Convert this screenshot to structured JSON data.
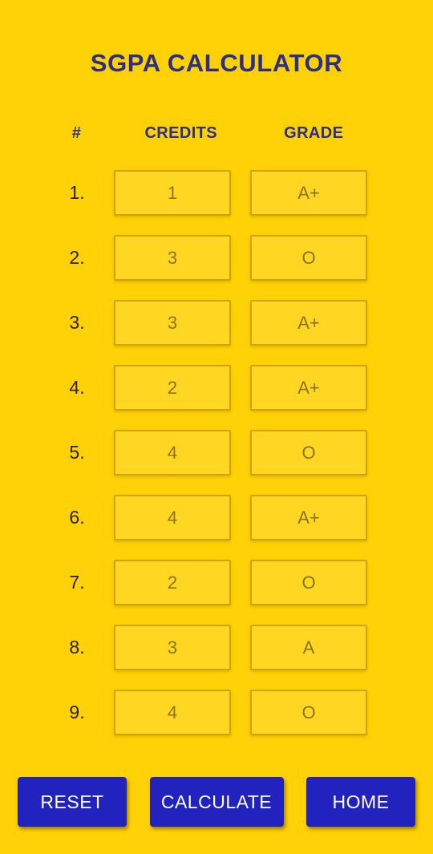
{
  "app": {
    "title": "SGPA CALCULATOR",
    "background_color": "#FFD106",
    "title_color": "#2E2E86",
    "accent_color": "#2222BE"
  },
  "table": {
    "headers": {
      "number": "#",
      "credits": "CREDITS",
      "grade": "GRADE"
    },
    "rows": [
      {
        "index": "1.",
        "credits": "1",
        "grade": "A+"
      },
      {
        "index": "2.",
        "credits": "3",
        "grade": "O"
      },
      {
        "index": "3.",
        "credits": "3",
        "grade": "A+"
      },
      {
        "index": "4.",
        "credits": "2",
        "grade": "A+"
      },
      {
        "index": "5.",
        "credits": "4",
        "grade": "O"
      },
      {
        "index": "6.",
        "credits": "4",
        "grade": "A+"
      },
      {
        "index": "7.",
        "credits": "2",
        "grade": "O"
      },
      {
        "index": "8.",
        "credits": "3",
        "grade": "A"
      },
      {
        "index": "9.",
        "credits": "4",
        "grade": "O"
      }
    ]
  },
  "buttons": {
    "reset": "RESET",
    "calculate": "CALCULATE",
    "home": "HOME"
  }
}
